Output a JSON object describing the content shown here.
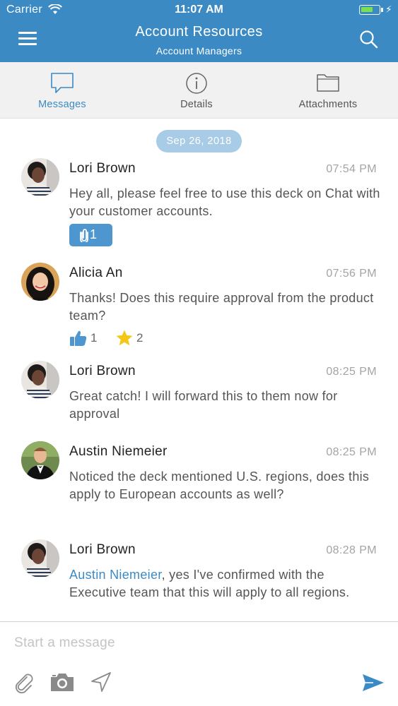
{
  "status_bar": {
    "carrier": "Carrier",
    "time": "11:07 AM",
    "battery_level": 0.7,
    "battery_color": "#7be04d"
  },
  "nav": {
    "title": "Account Resources",
    "subtitle": "Account Managers",
    "background": "#3b8ac4",
    "menu_icon": "hamburger-icon",
    "search_icon": "search-icon"
  },
  "tabs": [
    {
      "label": "Messages",
      "icon": "chat-bubble-icon",
      "active": true
    },
    {
      "label": "Details",
      "icon": "info-icon",
      "active": false
    },
    {
      "label": "Attachments",
      "icon": "folder-icon",
      "active": false
    }
  ],
  "date_divider": "Sep 26, 2018",
  "messages": [
    {
      "sender": "Lori Brown",
      "time": "07:54 PM",
      "text": "Hey all, please feel free to use this deck on Chat with your customer accounts.",
      "attachment_count": "1"
    },
    {
      "sender": "Alicia An",
      "time": "07:56 PM",
      "text": "Thanks! Does this require approval from the product team?",
      "reactions": [
        {
          "icon": "thumbs-up-icon",
          "count": "1"
        },
        {
          "icon": "star-icon",
          "count": "2"
        }
      ]
    },
    {
      "sender": "Lori Brown",
      "time": "08:25 PM",
      "text": "Great catch! I will forward this to them now for approval"
    },
    {
      "sender": "Austin Niemeier",
      "time": "08:25 PM",
      "text": "Noticed the deck mentioned U.S. regions, does this apply to European accounts as well?"
    },
    {
      "sender": "Lori Brown",
      "time": "08:28 PM",
      "mention": "Austin Niemeier",
      "text": ", yes I've confirmed with the Executive team that this will apply to all regions."
    }
  ],
  "composer": {
    "placeholder": "Start a message",
    "icons": [
      "paperclip-icon",
      "camera-icon",
      "location-arrow-icon",
      "send-icon"
    ]
  },
  "colors": {
    "accent": "#3b8ac4",
    "date_pill": "#a8cbe6",
    "attachment_badge": "#4d96cf",
    "star": "#f5c518",
    "thumbs_up": "#4d96cf"
  }
}
